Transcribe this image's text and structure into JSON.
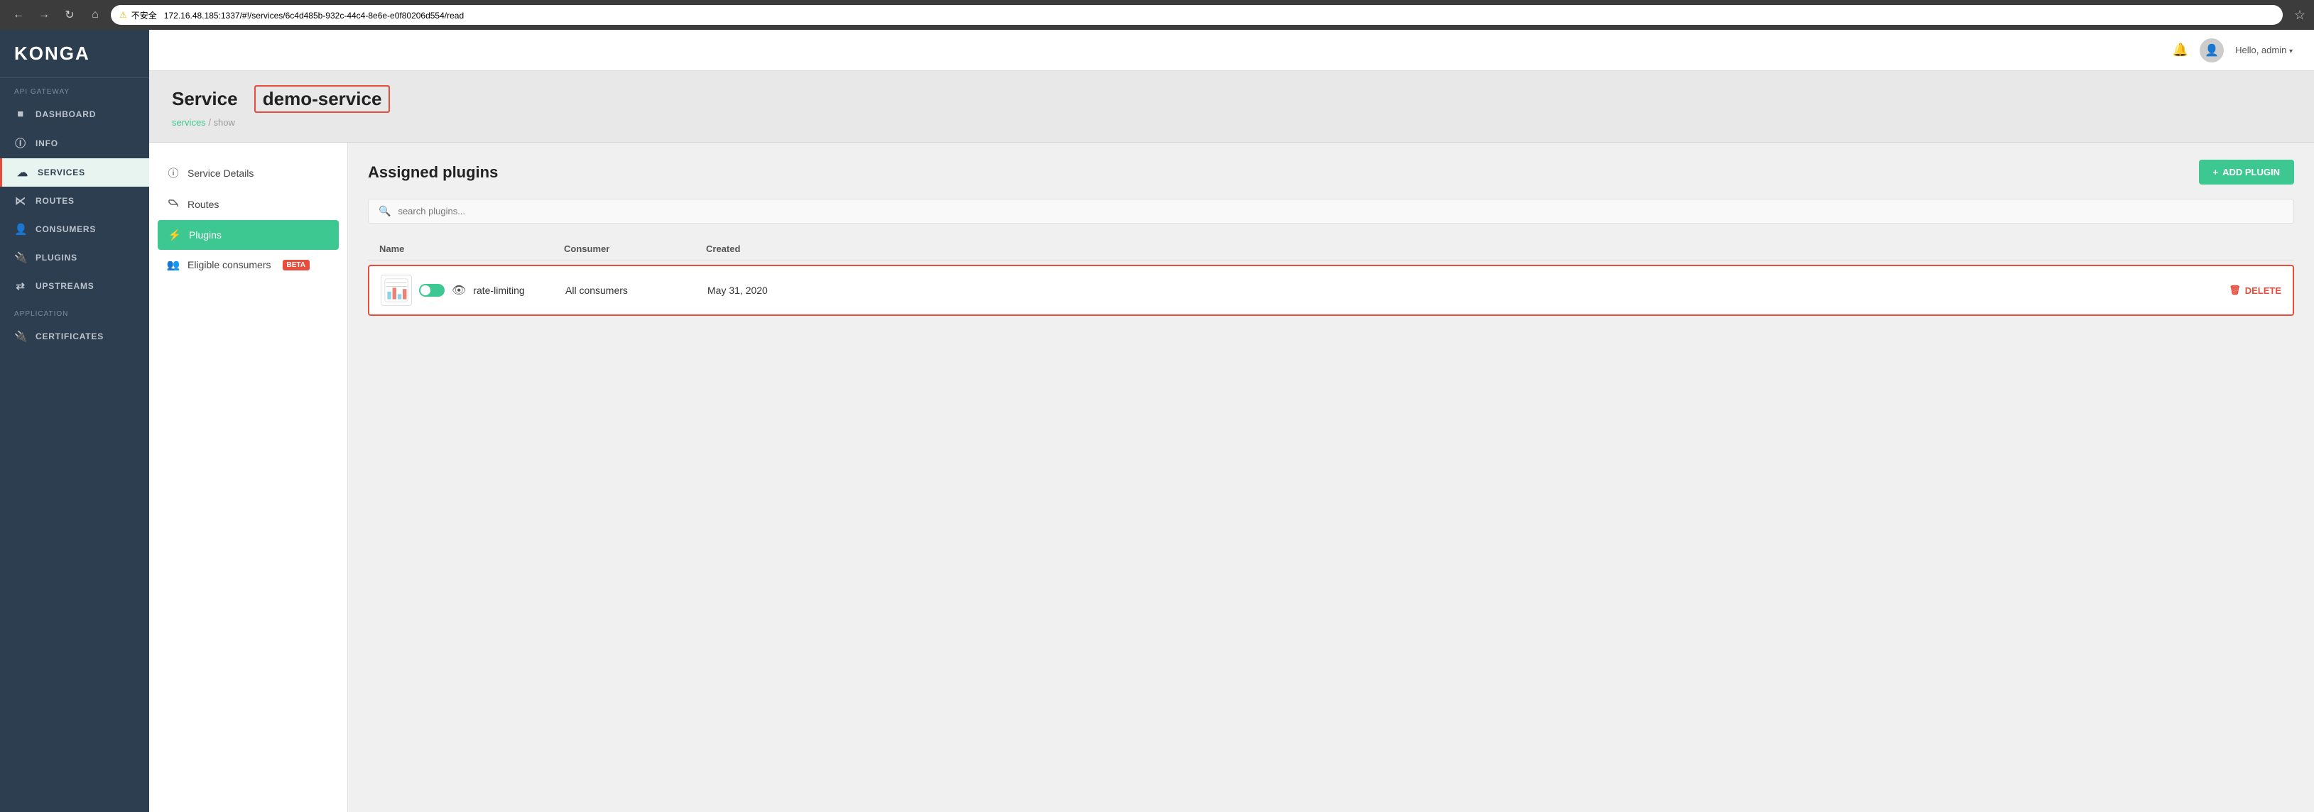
{
  "browser": {
    "back_btn": "←",
    "forward_btn": "→",
    "refresh_btn": "↻",
    "home_btn": "⌂",
    "security_label": "不安全",
    "url_host": "172.16.48.185",
    "url_port": ":1337",
    "url_path": "/#!/services/6c4d485b-932c-44c4-8e6e-e0f80206d554/read",
    "bookmark_icon": "★",
    "star_icon": "☆"
  },
  "sidebar": {
    "logo": "KONGA",
    "section_api_gateway": "API GATEWAY",
    "section_application": "APPLICATION",
    "items": [
      {
        "id": "dashboard",
        "label": "DASHBOARD",
        "icon": "⊞"
      },
      {
        "id": "info",
        "label": "INFO",
        "icon": "ⓘ"
      },
      {
        "id": "services",
        "label": "SERVICES",
        "icon": "☁",
        "active": true
      },
      {
        "id": "routes",
        "label": "ROUTES",
        "icon": "⑂"
      },
      {
        "id": "consumers",
        "label": "CONSUMERS",
        "icon": "👤"
      },
      {
        "id": "plugins",
        "label": "PLUGINS",
        "icon": "🔌"
      },
      {
        "id": "upstreams",
        "label": "UPSTREAMS",
        "icon": "⇄"
      },
      {
        "id": "certificates",
        "label": "CERTIFICATES",
        "icon": "🔌"
      }
    ]
  },
  "header": {
    "bell_icon": "🔔",
    "user_label": "Hello, admin",
    "dropdown_icon": "▾"
  },
  "page": {
    "title_prefix": "Service",
    "service_name": "demo-service",
    "breadcrumb_link": "services",
    "breadcrumb_separator": "/",
    "breadcrumb_current": "show"
  },
  "left_nav": {
    "items": [
      {
        "id": "service-details",
        "label": "Service Details",
        "icon": "ⓘ",
        "active": false
      },
      {
        "id": "routes",
        "label": "Routes",
        "icon": "⑂",
        "active": false
      },
      {
        "id": "plugins",
        "label": "Plugins",
        "icon": "🔌",
        "active": true
      },
      {
        "id": "eligible-consumers",
        "label": "Eligible consumers",
        "icon": "👥",
        "active": false,
        "badge": "beta"
      }
    ]
  },
  "plugins_panel": {
    "title": "Assigned plugins",
    "add_btn_icon": "+",
    "add_btn_label": "ADD PLUGIN",
    "search_placeholder": "search plugins...",
    "table_headers": {
      "name": "Name",
      "consumer": "Consumer",
      "created": "Created"
    },
    "plugins": [
      {
        "id": "rate-limiting",
        "name": "rate-limiting",
        "consumer": "All consumers",
        "created": "May 31, 2020",
        "enabled": true
      }
    ],
    "delete_icon": "🗑",
    "delete_label": "DELETE"
  }
}
